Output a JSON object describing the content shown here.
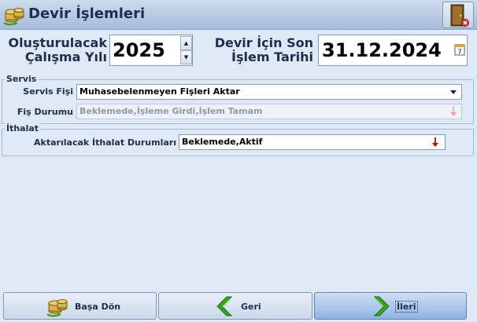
{
  "window": {
    "title": "Devir İşlemleri",
    "title_icon": "coins-refresh-icon",
    "exit_icon": "exit-door-icon"
  },
  "header": {
    "year_label_line1": "Oluşturulacak",
    "year_label_line2": "Çalışma Yılı",
    "year_value": "2025",
    "date_label_line1": "Devir İçin Son",
    "date_label_line2": "İşlem Tarihi",
    "date_value": "31.12.2024",
    "calendar_icon_day": "7"
  },
  "servis": {
    "group_title": "Servis",
    "fisi_label": "Servis Fişi",
    "fisi_value": "Muhasebelenmeyen Fişleri Aktar",
    "durum_label": "Fiş Durumu",
    "durum_value": "Beklemede,İşleme Girdi,İşlem Tamam"
  },
  "ithalat": {
    "group_title": "İthalat",
    "aktar_label": "Aktarılacak İthalat Durumları",
    "aktar_value": "Beklemede,Aktif"
  },
  "buttons": {
    "basa_don": "Başa Dön",
    "geri": "Geri",
    "ileri": "İleri"
  },
  "colors": {
    "background": "#dfe9f5",
    "title_text": "#1d2f4d",
    "arrow_green": "#3aa51c",
    "arrow_red": "#c00000"
  }
}
